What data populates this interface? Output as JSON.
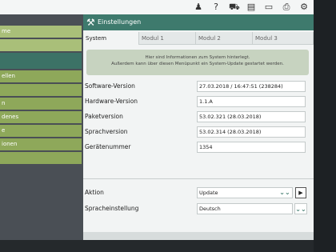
{
  "status_icons": [
    {
      "name": "person-icon",
      "glyph": "♟"
    },
    {
      "name": "help-icon",
      "glyph": "?"
    },
    {
      "name": "cart-icon",
      "glyph": "⛟"
    },
    {
      "name": "document-icon",
      "glyph": "▤"
    },
    {
      "name": "card-icon",
      "glyph": "▭"
    },
    {
      "name": "printer-icon",
      "glyph": "⎙"
    },
    {
      "name": "tools-icon",
      "glyph": "⚙"
    }
  ],
  "sidebar": {
    "items": [
      {
        "label": "me"
      },
      {
        "label": ""
      },
      {
        "label": ""
      },
      {
        "label": "ellen"
      },
      {
        "label": ""
      },
      {
        "label": "n"
      },
      {
        "label": "denes"
      },
      {
        "label": "e"
      },
      {
        "label": "ionen"
      },
      {
        "label": ""
      }
    ]
  },
  "header": {
    "title": "Einstellungen"
  },
  "tabs": [
    {
      "label": "System"
    },
    {
      "label": "Modul 1"
    },
    {
      "label": "Modul 2"
    },
    {
      "label": "Modul 3"
    }
  ],
  "info": {
    "line1": "Hier sind Informationen zum System hinterlegt.",
    "line2": "Außerdem kann über diesen Menüpunkt ein System-Update gestartet werden."
  },
  "fields": [
    {
      "label": "Software-Version",
      "value": "27.03.2018 / 16:47:51 (238284)"
    },
    {
      "label": "Hardware-Version",
      "value": "1.1.A"
    },
    {
      "label": "Paketversion",
      "value": "53.02.321 (28.03.2018)"
    },
    {
      "label": "Sprachversion",
      "value": "53.02.314 (28.03.2018)"
    },
    {
      "label": "Gerätenummer",
      "value": "1354"
    }
  ],
  "aktion": {
    "label": "Aktion",
    "value": "Update"
  },
  "sprache": {
    "label": "Spracheinstellung",
    "value": "Deutsch"
  },
  "colors": {
    "accent": "#3e7a6d",
    "sidebar_green": "#8ea85a"
  }
}
